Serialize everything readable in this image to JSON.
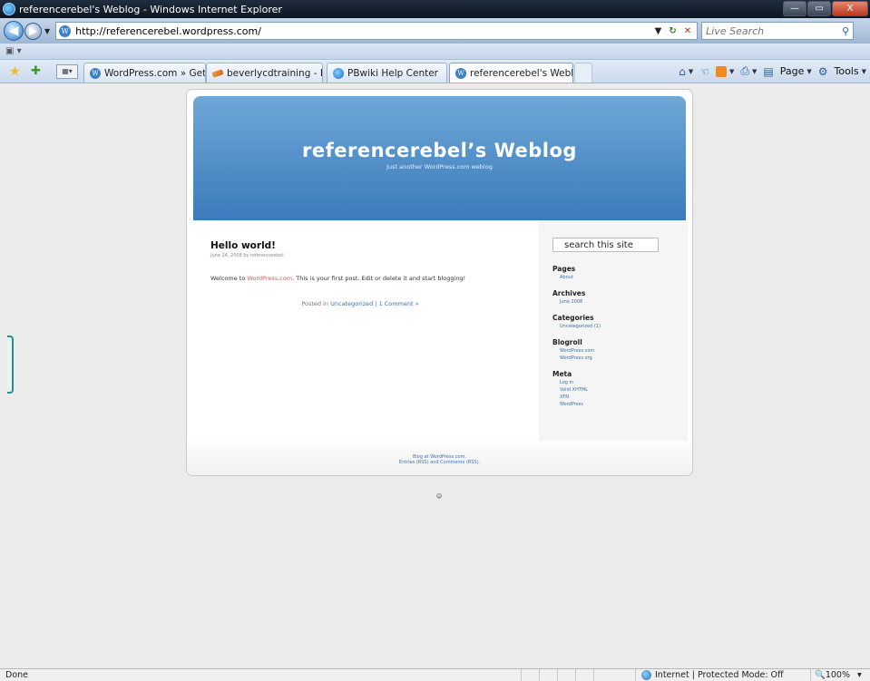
{
  "window": {
    "title": "referencerebel's Weblog - Windows Internet Explorer",
    "controls": [
      "—",
      "▭",
      "X"
    ]
  },
  "address_bar": {
    "url": "http://referencerebel.wordpress.com/",
    "search_placeholder": "Live Search"
  },
  "tabs": [
    {
      "label": "WordPress.com » Get a Fre...",
      "icon": "wordpress-icon",
      "active": false
    },
    {
      "label": "beverlycdtraining - Editing",
      "icon": "pencil-icon",
      "active": false
    },
    {
      "label": "PBwiki Help Center",
      "icon": "ie-icon",
      "active": false
    },
    {
      "label": "referencerebel's Weblog",
      "icon": "wordpress-icon",
      "active": true
    }
  ],
  "command_bar": {
    "page_label": "Page",
    "tools_label": "Tools"
  },
  "blog": {
    "title": "referencerebel’s Weblog",
    "description": "Just another WordPress.com weblog",
    "post": {
      "title": "Hello world!",
      "meta": "June 24, 2008 by referencerebel",
      "body_before": "Welcome to ",
      "body_link": "WordPress.com",
      "body_after": ". This is your first post. Edit or delete it and start blogging!",
      "posted_in": "Posted in ",
      "category": "Uncategorized",
      "separator": " | ",
      "comments": "1 Comment »"
    },
    "sidebar": {
      "search_value": "search this site",
      "widgets": [
        {
          "heading": "Pages",
          "links": [
            "About"
          ]
        },
        {
          "heading": "Archives",
          "links": [
            "June 2008"
          ]
        },
        {
          "heading": "Categories",
          "links": [
            "Uncategorized (1)"
          ]
        },
        {
          "heading": "Blogroll",
          "links": [
            "WordPress.com",
            "WordPress.org"
          ]
        },
        {
          "heading": "Meta",
          "links": [
            "Log in",
            "Valid XHTML",
            "XFN",
            "WordPress"
          ]
        }
      ]
    },
    "footer": {
      "line1": "Blog at WordPress.com.",
      "line2": "Entries (RSS) and Comments (RSS)."
    },
    "smiley": "☺"
  },
  "status_bar": {
    "status": "Done",
    "zone": "Internet | Protected Mode: Off",
    "zoom": "100%"
  },
  "colors": {
    "header_top": "#6fa7d8",
    "header_bottom": "#3a7bbb",
    "link": "#3a70b0",
    "post_link": "#c8645e"
  }
}
